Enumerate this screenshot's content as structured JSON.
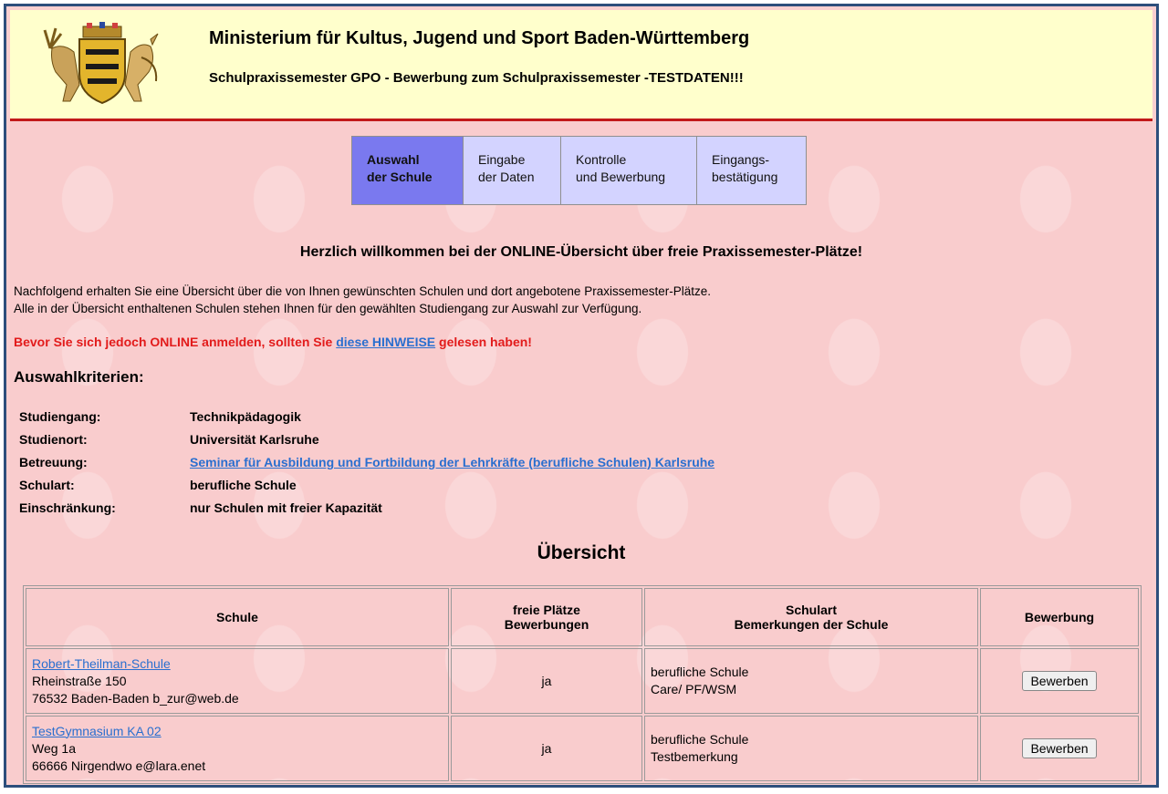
{
  "header": {
    "title": "Ministerium für Kultus, Jugend und Sport Baden-Württemberg",
    "subtitle": "Schulpraxissemester GPO - Bewerbung zum Schulpraxissemester -TESTDATEN!!!",
    "logo": "coat-of-arms"
  },
  "steps": [
    {
      "line1": "Auswahl",
      "line2": "der Schule",
      "active": true
    },
    {
      "line1": "Eingabe",
      "line2": "der Daten",
      "active": false
    },
    {
      "line1": "Kontrolle",
      "line2": "und Bewerbung",
      "active": false
    },
    {
      "line1": "Eingangs-",
      "line2": "bestätigung",
      "active": false
    }
  ],
  "welcome": "Herzlich willkommen bei der ONLINE-Übersicht über freie Praxissemester-Plätze!",
  "intro": {
    "line1": "Nachfolgend erhalten Sie eine Übersicht über die von Ihnen gewünschten Schulen und dort angebotene Praxissemester-Plätze.",
    "line2": "Alle in der Übersicht enthaltenen Schulen stehen Ihnen für den gewählten Studiengang zur Auswahl zur Verfügung."
  },
  "warning": {
    "before": "Bevor Sie sich jedoch ONLINE anmelden, sollten Sie ",
    "link": "diese HINWEISE",
    "after": " gelesen haben!"
  },
  "criteria": {
    "title": "Auswahlkriterien:",
    "rows": [
      {
        "label": "Studiengang:",
        "value": "Technikpädagogik"
      },
      {
        "label": "Studienort:",
        "value": "Universität Karlsruhe"
      },
      {
        "label": "Betreuung:",
        "value": "Seminar für Ausbildung und Fortbildung der Lehrkräfte (berufliche Schulen) Karlsruhe"
      },
      {
        "label": "Schulart:",
        "value": "berufliche Schule"
      },
      {
        "label": "Einschränkung:",
        "value": "nur Schulen mit freier Kapazität"
      }
    ]
  },
  "overview": {
    "title": "Übersicht",
    "headers": {
      "school": "Schule",
      "places1": "freie Plätze",
      "places2": "Bewerbungen",
      "type1": "Schulart",
      "type2": "Bemerkungen der Schule",
      "apply": "Bewerbung"
    },
    "rows": [
      {
        "name": "Robert-Theilman-Schule",
        "street": "Rheinstraße 150",
        "city": "76532 Baden-Baden b_zur@web.de",
        "places": "ja",
        "type": "berufliche Schule",
        "remark": "Care/ PF/WSM",
        "button": "Bewerben"
      },
      {
        "name": "TestGymnasium KA 02",
        "street": "Weg 1a",
        "city": "66666 Nirgendwo e@lara.enet",
        "places": "ja",
        "type": "berufliche Schule",
        "remark": "Testbemerkung",
        "button": "Bewerben"
      }
    ]
  }
}
